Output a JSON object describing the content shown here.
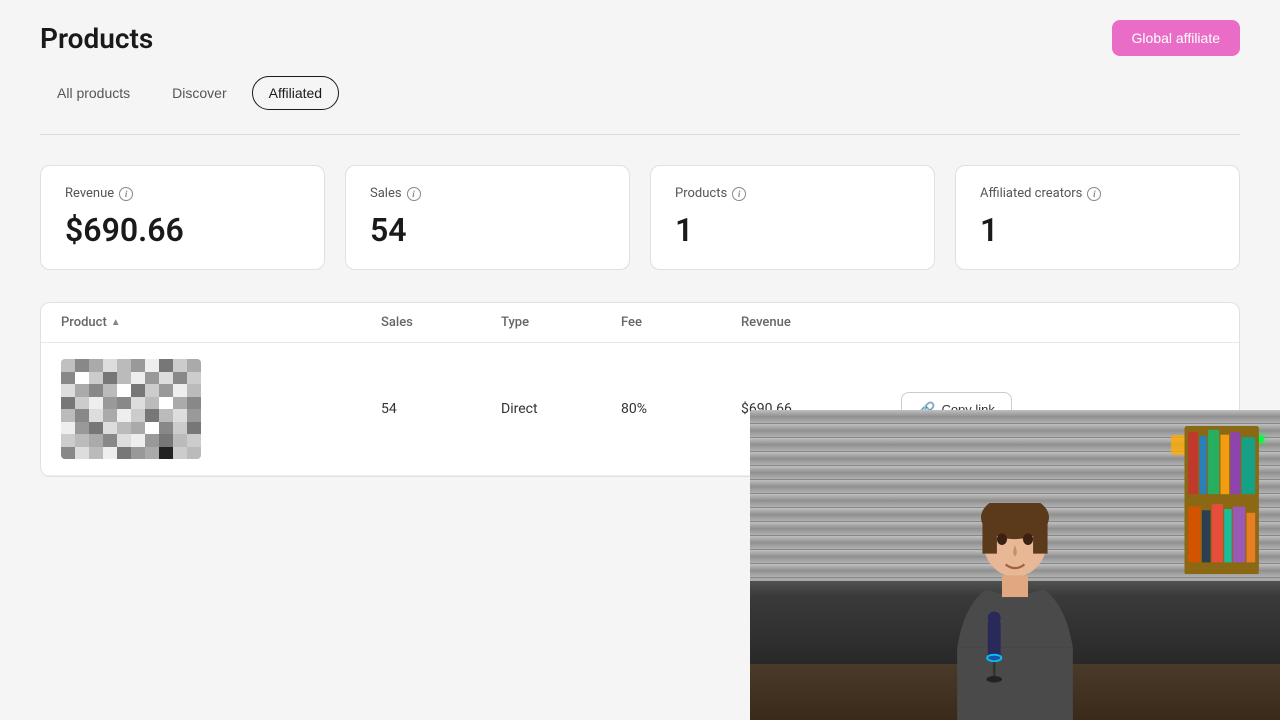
{
  "page": {
    "title": "Products"
  },
  "header": {
    "global_affiliate_btn": "Global affiliate"
  },
  "tabs": [
    {
      "id": "all-products",
      "label": "All products",
      "active": false
    },
    {
      "id": "discover",
      "label": "Discover",
      "active": false
    },
    {
      "id": "affiliated",
      "label": "Affiliated",
      "active": true
    }
  ],
  "stats": [
    {
      "id": "revenue",
      "label": "Revenue",
      "value": "$690.66"
    },
    {
      "id": "sales",
      "label": "Sales",
      "value": "54"
    },
    {
      "id": "products",
      "label": "Products",
      "value": "1"
    },
    {
      "id": "affiliated-creators",
      "label": "Affiliated creators",
      "value": "1"
    }
  ],
  "table": {
    "columns": [
      {
        "id": "product",
        "label": "Product",
        "sortable": true
      },
      {
        "id": "sales",
        "label": "Sales",
        "sortable": false
      },
      {
        "id": "type",
        "label": "Type",
        "sortable": false
      },
      {
        "id": "fee",
        "label": "Fee",
        "sortable": false
      },
      {
        "id": "revenue",
        "label": "Revenue",
        "sortable": false
      },
      {
        "id": "actions",
        "label": "",
        "sortable": false
      }
    ],
    "rows": [
      {
        "sales": "54",
        "type": "Direct",
        "fee": "80%",
        "revenue": "$690.66",
        "copy_link_label": "Copy link"
      }
    ]
  },
  "pixel_colors": [
    "#c0c0c0",
    "#888",
    "#aaa",
    "#ddd",
    "#bbb",
    "#999",
    "#eee",
    "#777",
    "#ccc",
    "#aaa",
    "#888",
    "#fff",
    "#ccc",
    "#777",
    "#bbb",
    "#eee",
    "#999",
    "#ddd",
    "#888",
    "#ccc",
    "#ddd",
    "#aaa",
    "#888",
    "#bbb",
    "#fff",
    "#777",
    "#ccc",
    "#999",
    "#eee",
    "#bbb",
    "#777",
    "#ccc",
    "#eee",
    "#999",
    "#888",
    "#ddd",
    "#bbb",
    "#fff",
    "#aaa",
    "#888",
    "#bbb",
    "#888",
    "#ddd",
    "#aaa",
    "#eee",
    "#ccc",
    "#777",
    "#bbb",
    "#ddd",
    "#999",
    "#eee",
    "#999",
    "#777",
    "#ddd",
    "#bbb",
    "#aaa",
    "#fff",
    "#888",
    "#ccc",
    "#777",
    "#ccc",
    "#bbb",
    "#aaa",
    "#888",
    "#ddd",
    "#eee",
    "#999",
    "#777",
    "#bbb",
    "#ccc",
    "#888",
    "#ddd",
    "#bbb",
    "#eee",
    "#777",
    "#999",
    "#aaa",
    "#222",
    "#ccc",
    "#bbb",
    "#000",
    "#aaa",
    "#999",
    "#777",
    "#bbb",
    "#888",
    "#ddd",
    "#eee",
    "#ccc",
    "#fff",
    "#ccc",
    "#888",
    "#eee",
    "#bbb",
    "#aaa",
    "#ddd",
    "#777",
    "#999",
    "#bbb",
    "#888",
    "#ddd",
    "#bbb",
    "#777",
    "#aaa",
    "#ccc",
    "#888",
    "#eee",
    "#999",
    "#ddd",
    "#aaa",
    "#aaa",
    "#eee",
    "#888",
    "#ccc",
    "#999",
    "#bbb",
    "#777",
    "#ddd",
    "#aaa",
    "#ccc"
  ]
}
